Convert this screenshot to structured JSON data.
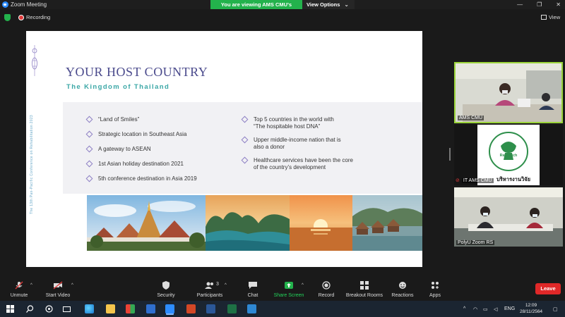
{
  "window": {
    "title": "Zoom Meeting",
    "minimize": "—",
    "maximize": "❐",
    "close": "✕"
  },
  "banner": {
    "message": "You are viewing AMS CMU's screen",
    "options_label": "View Options",
    "options_caret": "⌄"
  },
  "statusbar": {
    "recording_label": "Recording",
    "view_label": "View"
  },
  "slide": {
    "vertical_text": "The 13th Pan-Pacific Conference on Rehabilitation 2023",
    "title": "YOUR HOST COUNTRY",
    "subtitle": "The Kingdom of Thailand",
    "bullets_left": [
      "“Land of Smiles”",
      "Strategic location in Southeast Asia",
      "A gateway to ASEAN",
      "1st Asian holiday destination 2021",
      "5th conference destination in Asia 2019"
    ],
    "bullets_right": [
      [
        "Top 5 countries in the world with",
        "“The hospitable host DNA”"
      ],
      [
        "Upper middle-income nation that is",
        "also a donor"
      ],
      [
        "Healthcare services have been the core",
        "of the country’s development"
      ]
    ],
    "colors": {
      "title": "#4a4a8c",
      "subtitle": "#3aa7a6",
      "bullet": "#8d7fc4"
    }
  },
  "participants": [
    {
      "name": "AMS CMU"
    },
    {
      "name": "IT AMS CMU",
      "logo_text": "Research",
      "overlay_text": "บริหารงานวิจัย"
    },
    {
      "name": "PolyU Zoom RS"
    }
  ],
  "toolbar": {
    "unmute": "Unmute",
    "start_video": "Start Video",
    "security": "Security",
    "participants": "Participants",
    "participants_count": "3",
    "chat": "Chat",
    "share_screen": "Share Screen",
    "record": "Record",
    "breakout_rooms": "Breakout Rooms",
    "reactions": "Reactions",
    "apps": "Apps",
    "leave": "Leave",
    "caret": "^"
  },
  "taskbar": {
    "tray_caret": "^",
    "language": "ENG",
    "time": "12:09",
    "date": "28/11/2564"
  },
  "icons": {
    "windows": "windows-icon",
    "search": "search-icon",
    "task_view": "task-view-icon"
  }
}
